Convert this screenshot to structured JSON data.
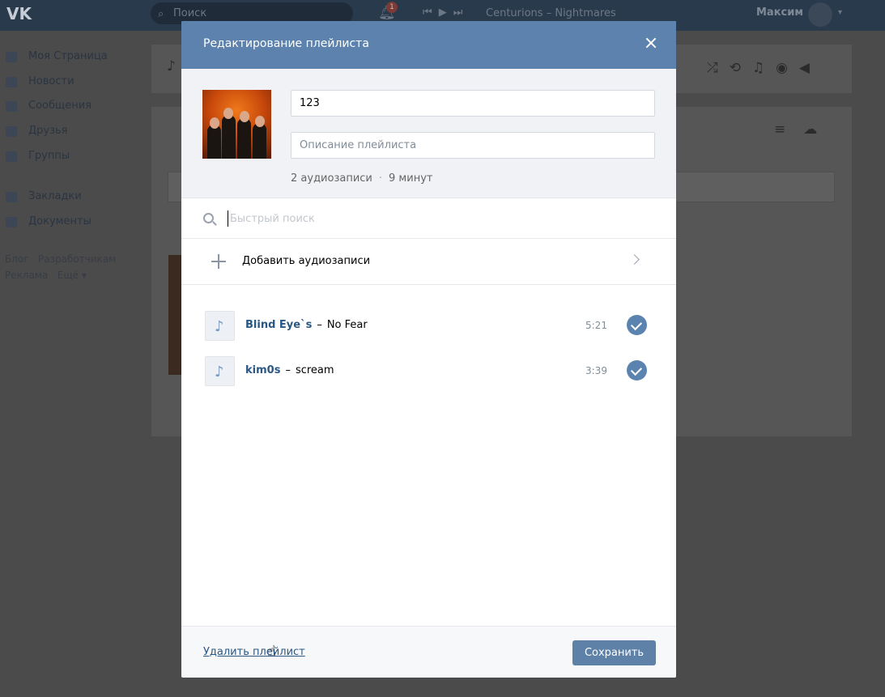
{
  "topbar": {
    "logo": "VK",
    "search_placeholder": "Поиск",
    "notification_count": "1",
    "now_playing": "Centurions – Nightmares",
    "user_name": "Максим"
  },
  "sidebar": {
    "items": [
      {
        "label": "Моя Страница",
        "icon": "user-icon"
      },
      {
        "label": "Новости",
        "icon": "news-icon"
      },
      {
        "label": "Сообщения",
        "icon": "messages-icon"
      },
      {
        "label": "Друзья",
        "icon": "friends-icon"
      },
      {
        "label": "Группы",
        "icon": "groups-icon"
      },
      {
        "label": "Закладки",
        "icon": "star-icon"
      },
      {
        "label": "Документы",
        "icon": "document-icon"
      }
    ],
    "footer": {
      "blog": "Блог",
      "developers": "Разработчикам",
      "ads": "Реклама",
      "more": "Ещё"
    }
  },
  "modal": {
    "title": "Редактирование плейлиста",
    "playlist_name": "123",
    "description_placeholder": "Описание плейлиста",
    "track_count": "2 аудиозаписи",
    "duration": "9 минут",
    "search_placeholder": "Быстрый поиск",
    "add_label": "Добавить аудиозаписи",
    "tracks": [
      {
        "artist": "Blind Eye`s",
        "title": "No Fear",
        "duration": "5:21"
      },
      {
        "artist": "kim0s",
        "title": "scream",
        "duration": "3:39"
      }
    ],
    "delete_label": "Удалить плейлист",
    "save_label": "Сохранить"
  },
  "colors": {
    "header": "#5c82ad",
    "accent": "#5e81a8",
    "link": "#2a5885",
    "overlay_bg": "#4b4b4b"
  }
}
